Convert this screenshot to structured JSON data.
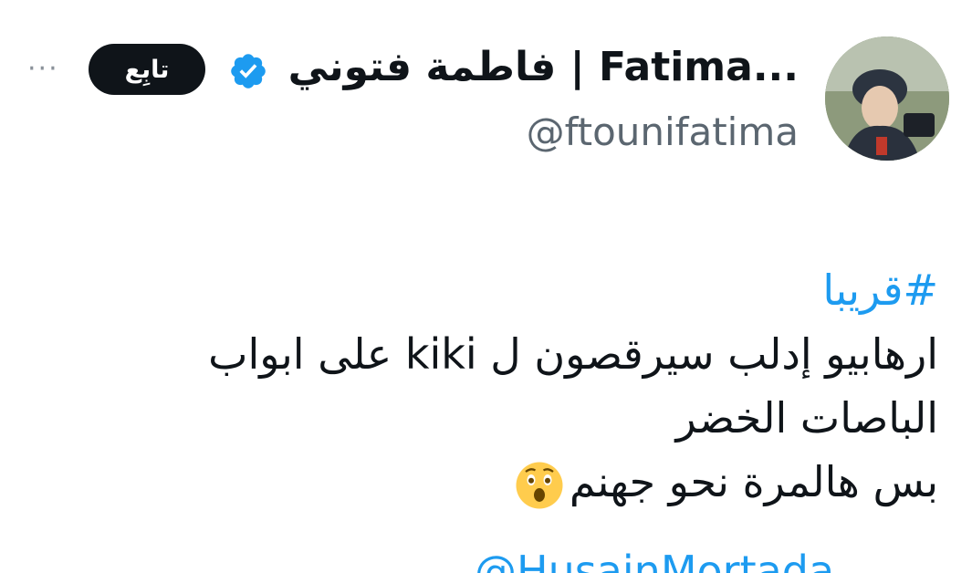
{
  "header": {
    "display_name": "فاطمة فتوني | Fatima...",
    "handle": "@ftounifatima",
    "follow_label": "تابِع",
    "more_label": "···"
  },
  "tweet": {
    "hashtag": "#قريبا",
    "line1": "ارهابيو إدلب سيرقصون ل kiki على  ابواب",
    "line2": "الباصات الخضر",
    "line3": "بس هالمرة نحو جهنم",
    "mention_partial": "@HusainMortada"
  },
  "colors": {
    "accent": "#1d9bf0",
    "verified": "#1d9bf0",
    "follow_bg": "#0f1419",
    "handle": "#5b6670"
  },
  "icons": {
    "verified": "verified-badge-icon",
    "emoji": "astonished-face-icon"
  }
}
